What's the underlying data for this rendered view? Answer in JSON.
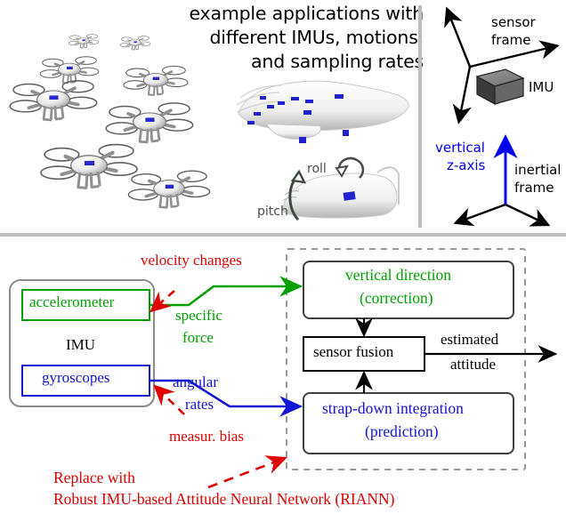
{
  "figure": {
    "top": {
      "heading_lines": [
        "example applications with",
        "different IMUs, motions,",
        "and sampling rates"
      ],
      "illustrations": {
        "drones_label": "quadcopter-drones-photo-cluster",
        "hand_label": "hand-with-imu-sensors-photo",
        "foot_label": "foot-with-imu-sensor-photo"
      },
      "motion_labels": [
        {
          "text": "roll",
          "color": "#4d4d4d"
        },
        {
          "text": "pitch",
          "color": "#4d4d4d"
        }
      ],
      "frames_panel": {
        "sensor_frame_lines": [
          "sensor",
          "frame"
        ],
        "imu_label": "IMU",
        "vertical_axis_lines": [
          "vertical",
          "z-axis"
        ],
        "vertical_axis_color": "#0000ee",
        "inertial_frame_lines": [
          "inertial",
          "frame"
        ]
      }
    },
    "bottom": {
      "imu_group_label": "IMU",
      "sensor_boxes": [
        {
          "label": "accelerometer",
          "color": "#00a000"
        },
        {
          "label": "gyroscopes",
          "color": "#1414d6"
        }
      ],
      "signal_labels": [
        {
          "lines": [
            "specific",
            "force"
          ],
          "color": "#00a000"
        },
        {
          "lines": [
            "angular",
            "rates"
          ],
          "color": "#1414d6"
        }
      ],
      "annotations": [
        {
          "text": "velocity changes",
          "color": "#e00000"
        },
        {
          "text": "measur. bias",
          "color": "#e00000"
        }
      ],
      "process_boxes": [
        {
          "lines": [
            "vertical direction",
            "(correction)"
          ],
          "color": "#00a000"
        },
        {
          "lines": [
            "sensor fusion"
          ],
          "color": "#000000"
        },
        {
          "lines": [
            "strap-down integration",
            "(prediction)"
          ],
          "color": "#1414d6"
        }
      ],
      "output_label_lines": [
        "estimated",
        "attitude"
      ],
      "footer_lines": [
        "Replace with",
        "Robust IMU-based Attitude Neural Network (RIANN)"
      ],
      "footer_color": "#e00000"
    },
    "colors": {
      "green": "#00a000",
      "blue": "#1414d6",
      "red": "#e00000",
      "black": "#000000",
      "gray_box": "#8c8c8c",
      "dashed_gray": "#999999",
      "divider": "#c0c0c0"
    }
  }
}
